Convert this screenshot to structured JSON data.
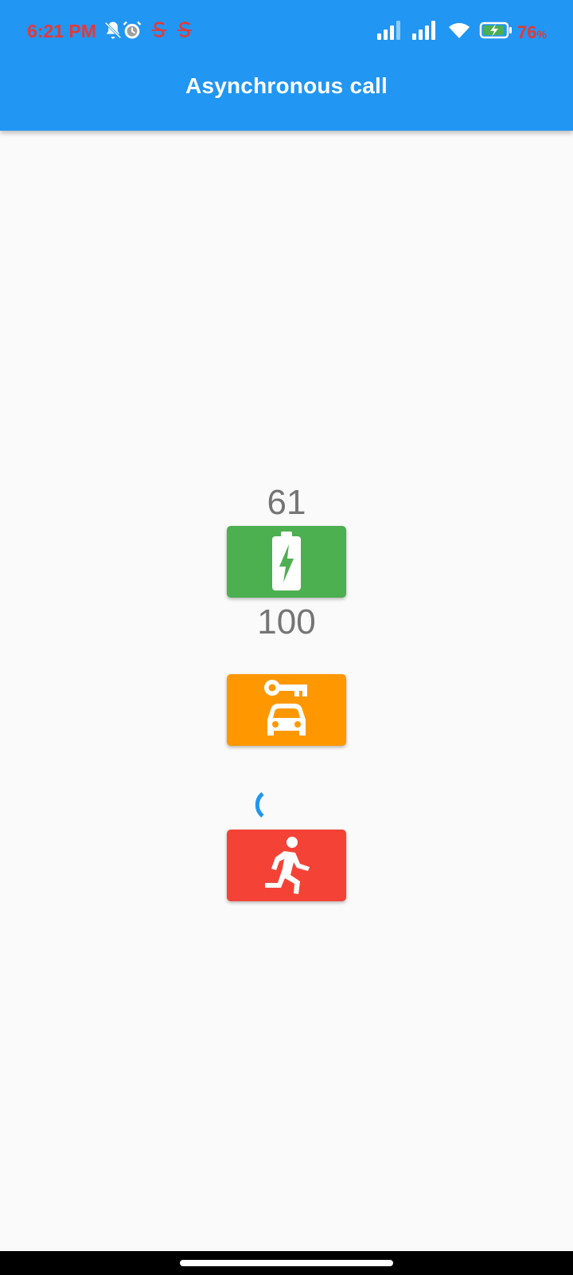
{
  "status_bar": {
    "time": "6:21 PM",
    "battery_percent": "76",
    "battery_percent_suffix": "%",
    "text_color": "#e53935",
    "icons": [
      "muted-bell-icon",
      "alarm-clock-icon",
      "app-s-icon",
      "app-s-icon",
      "signal-strength-icon",
      "signal-strength-icon",
      "wifi-icon",
      "battery-charging-icon"
    ]
  },
  "app_bar": {
    "title": "Asynchronous call",
    "color": "#2196f3"
  },
  "main": {
    "first_value": "61",
    "second_value": "100",
    "buttons": [
      {
        "name": "battery-charging-button",
        "icon": "battery-charging-icon",
        "color": "#4caf50"
      },
      {
        "name": "car-rental-button",
        "icon": "car-key-icon",
        "color": "#ff9800"
      },
      {
        "name": "run-button",
        "icon": "running-person-icon",
        "color": "#f44336"
      }
    ],
    "spinner_color": "#2196f3"
  }
}
